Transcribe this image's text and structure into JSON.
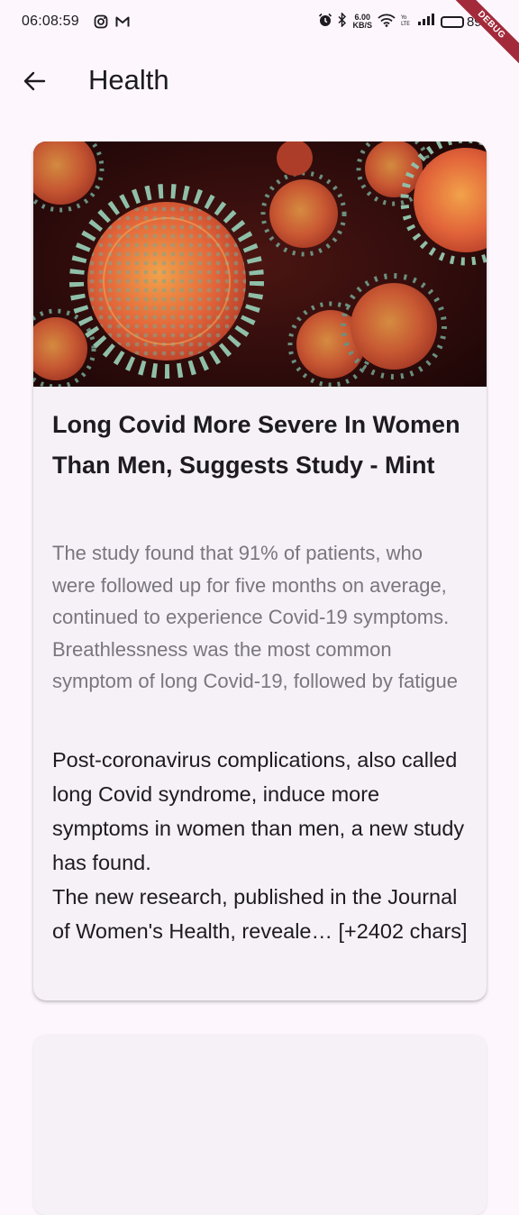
{
  "status_bar": {
    "time": "06:08:59",
    "net_speed_value": "6.00",
    "net_speed_unit": "KB/S",
    "battery_percent": "89",
    "battery_level": 0.89,
    "debug_label": "DEBUG"
  },
  "app_bar": {
    "title": "Health"
  },
  "article": {
    "title": "Long Covid More Severe In Women Than Men, Suggests Study - Mint",
    "description": "The study found that 91% of patients, who were followed up for five months on average, continued to experience Covid-19 symptoms. Breathlessness was the most common symptom of long Covid-19, followed by fatigue",
    "content_line1": "Post-coronavirus complications, also called long Covid syndrome, induce more symptoms in women than men, a new study has found.",
    "content_line2": "The new research, published in the Journal of Women's Health, reveale… [+2402 chars]"
  },
  "colors": {
    "background": "#fdf7fd",
    "card": "#f6f0f7",
    "title_text": "#1d1b20",
    "description_text": "#79767d",
    "debug_banner": "#a32a3a"
  },
  "icons": [
    "alarm-icon",
    "bluetooth-icon",
    "wifi-icon",
    "signal-icon",
    "battery-icon",
    "instagram-icon",
    "gmail-icon",
    "back-arrow-icon"
  ]
}
